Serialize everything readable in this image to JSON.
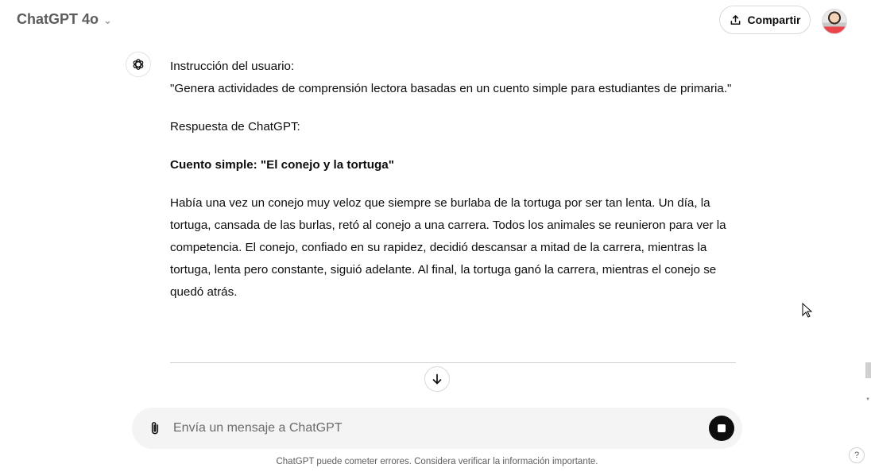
{
  "header": {
    "model_label": "ChatGPT 4o",
    "share_label": "Compartir"
  },
  "message": {
    "intro_label": "Instrucción del usuario:",
    "user_prompt": "\"Genera actividades de comprensión lectora basadas en un cuento simple para estudiantes de primaria.\"",
    "response_label": "Respuesta de ChatGPT:",
    "story_title": "Cuento simple: \"El conejo y la tortuga\"",
    "story_body": "Había una vez un conejo muy veloz que siempre se burlaba de la tortuga por ser tan lenta. Un día, la tortuga, cansada de las burlas, retó al conejo a una carrera. Todos los animales se reunieron para ver la competencia. El conejo, confiado en su rapidez, decidió descansar a mitad de la carrera, mientras la tortuga, lenta pero constante, siguió adelante. Al final, la tortuga ganó la carrera, mientras el conejo se quedó atrás."
  },
  "composer": {
    "placeholder": "Envía un mensaje a ChatGPT"
  },
  "footer": {
    "disclaimer": "ChatGPT puede cometer errores. Considera verificar la información importante.",
    "help_label": "?"
  },
  "icons": {
    "model_chevron": "chevron-down-icon",
    "share": "share-icon",
    "assistant": "openai-logo-icon",
    "scroll_down": "arrow-down-icon",
    "attach": "paperclip-icon",
    "stop": "stop-icon"
  }
}
